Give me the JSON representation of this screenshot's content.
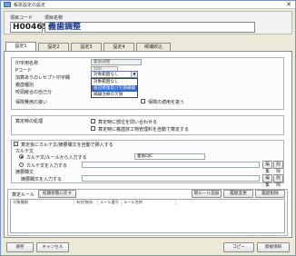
{
  "window": {
    "title": "帳票設定の設定"
  },
  "header": {
    "code_label": "項目コード",
    "name_label": "項目名称",
    "code_value": "H00465",
    "name_value": "義歯調整"
  },
  "tabs": [
    "設定1",
    "設定2",
    "設定3",
    "設定4",
    "候補絞込"
  ],
  "basic": {
    "print_name_label": "印字用名称",
    "print_name_value": "義歯調整",
    "pcode_label": "Pコード",
    "pcode_value": "500",
    "receipt_label": "加算ありのレセプト印字欄",
    "receipt_value": "対象範囲なし",
    "receipt_options": [
      "対象範囲なし",
      "歯冠修復及び欠損補綴",
      "補綴治療の欠損"
    ],
    "selected_option_index": 1,
    "denture_label": "義歯種別",
    "occlusion_label": "咬頭嵌合の自己分",
    "pay_label": "保険費用の扱い",
    "pay_checkbox_label": "保険の適用を扱う"
  },
  "calc": {
    "label": "算定時の処理",
    "check1": "算定時に部位を問い合わせる",
    "check2": "算定時に義歯技工物管理料を自動で算定する"
  },
  "karte": {
    "auto_insert_label": "算定後にカルテ文/摘要欄文を自動で挿入する",
    "karte_label": "カルテ文",
    "radio1_label": "カルテ文/ルールから入力する",
    "radio1_select": "義歯DJC",
    "radio2_label": "カルテ文を入力する",
    "edit_btn": "編集",
    "delete_btn": "削除",
    "tekiyo_label": "摘要欄文",
    "tekiyo_input_label": "摘要欄文を入力する"
  },
  "rules": {
    "label": "算定ルール",
    "reset_btn": "初期状態に戻す",
    "add_btn": "新ルール追加",
    "change_btn": "履歴変更",
    "delete_btn": "履歴削除",
    "columns": [
      "対象種類",
      "有効/無効",
      "ルール番号",
      "ルール名称"
    ]
  },
  "footer": {
    "save": "保存",
    "cancel": "キャンセル",
    "copy": "コピー",
    "new_item": "新規項目"
  }
}
